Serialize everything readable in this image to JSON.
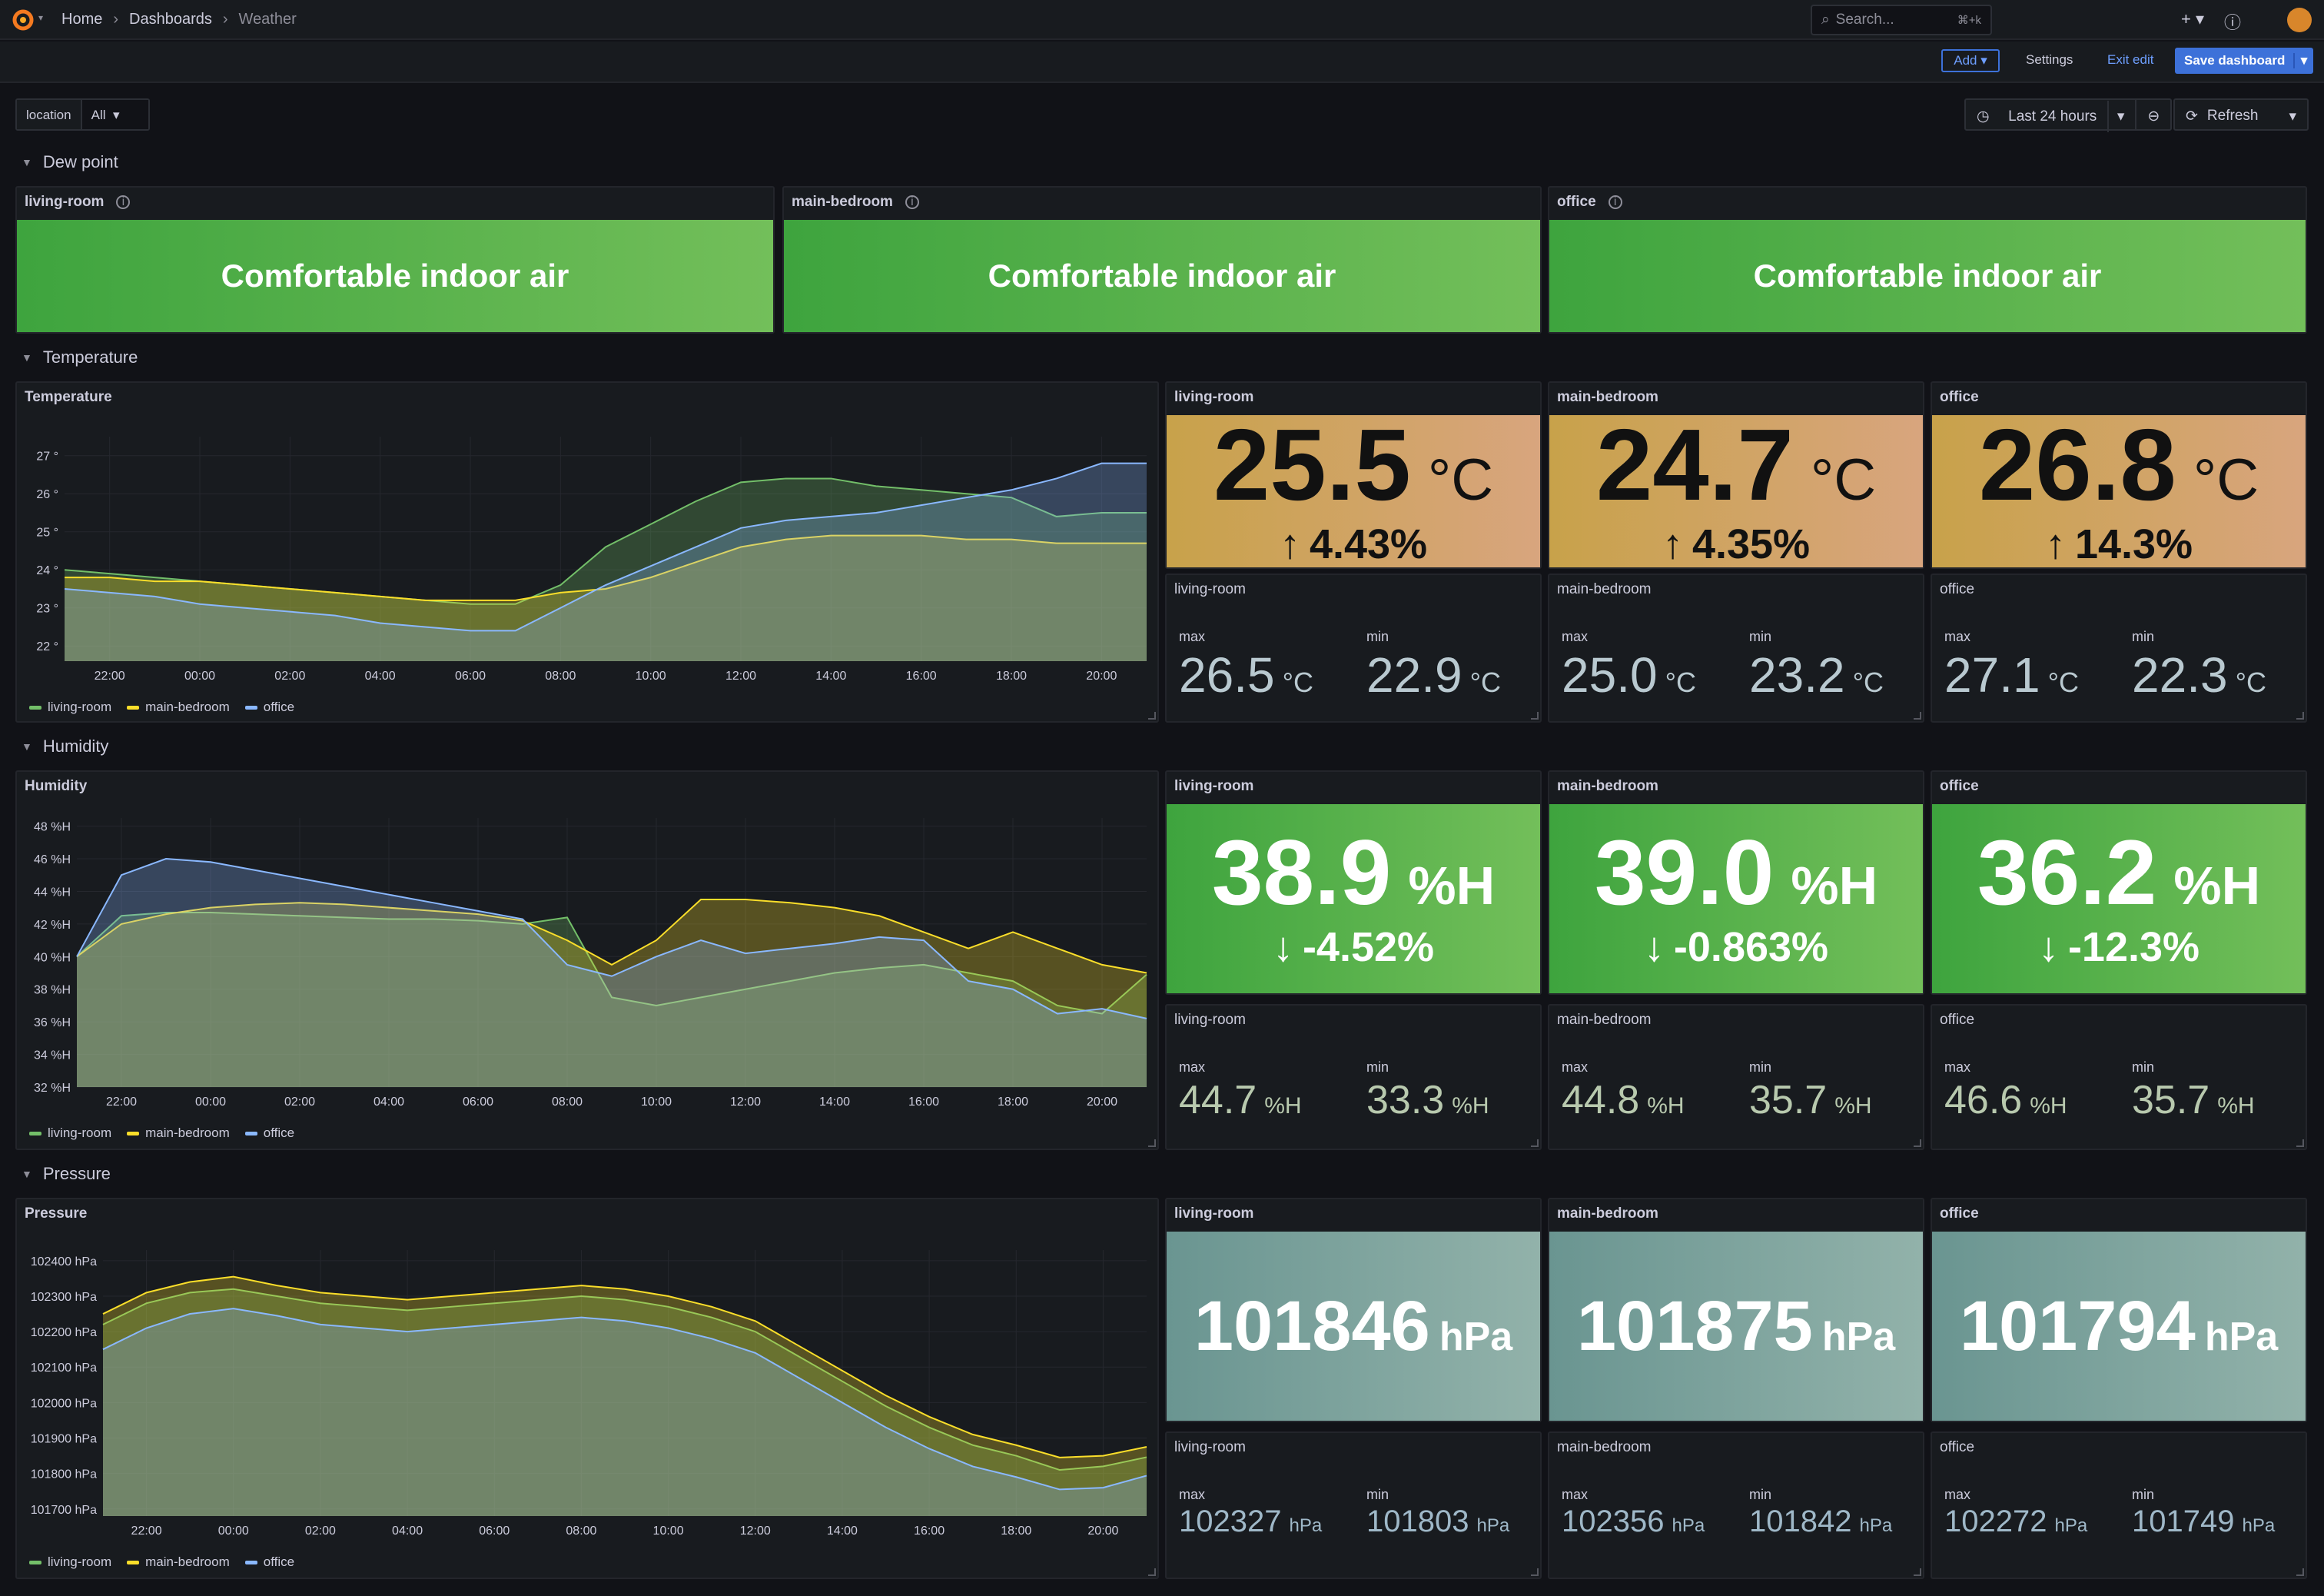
{
  "breadcrumb": {
    "home": "Home",
    "dashboards": "Dashboards",
    "current": "Weather"
  },
  "search": {
    "placeholder": "Search...",
    "shortcut": "⌘+k"
  },
  "toolbar": {
    "add": "Add",
    "settings": "Settings",
    "exit_edit": "Exit edit",
    "save": "Save dashboard"
  },
  "variable": {
    "label": "location",
    "value": "All"
  },
  "time": {
    "range": "Last 24 hours",
    "refresh": "Refresh"
  },
  "colors": {
    "living_room": "#73bf69",
    "main_bedroom": "#fade2a",
    "office": "#8ab8ff",
    "accent": "#3d71d9"
  },
  "rows": {
    "dew": "Dew point",
    "temperature": "Temperature",
    "humidity": "Humidity",
    "pressure": "Pressure"
  },
  "dew": [
    {
      "title": "living-room",
      "text": "Comfortable indoor air"
    },
    {
      "title": "main-bedroom",
      "text": "Comfortable indoor air"
    },
    {
      "title": "office",
      "text": "Comfortable indoor air"
    }
  ],
  "temperature": {
    "chart_title": "Temperature",
    "stats": [
      {
        "title": "living-room",
        "value": "25.5",
        "unit": "°C",
        "delta": "4.43%",
        "dir": "up"
      },
      {
        "title": "main-bedroom",
        "value": "24.7",
        "unit": "°C",
        "delta": "4.35%",
        "dir": "up"
      },
      {
        "title": "office",
        "value": "26.8",
        "unit": "°C",
        "delta": "14.3%",
        "dir": "up"
      }
    ],
    "minmax": [
      {
        "title": "living-room",
        "max_label": "max",
        "max": "26.5",
        "min_label": "min",
        "min": "22.9",
        "unit": "°C"
      },
      {
        "title": "main-bedroom",
        "max_label": "max",
        "max": "25.0",
        "min_label": "min",
        "min": "23.2",
        "unit": "°C"
      },
      {
        "title": "office",
        "max_label": "max",
        "max": "27.1",
        "min_label": "min",
        "min": "22.3",
        "unit": "°C"
      }
    ]
  },
  "humidity": {
    "chart_title": "Humidity",
    "stats": [
      {
        "title": "living-room",
        "value": "38.9",
        "unit": "%H",
        "delta": "-4.52%",
        "dir": "down"
      },
      {
        "title": "main-bedroom",
        "value": "39.0",
        "unit": "%H",
        "delta": "-0.863%",
        "dir": "down"
      },
      {
        "title": "office",
        "value": "36.2",
        "unit": "%H",
        "delta": "-12.3%",
        "dir": "down"
      }
    ],
    "minmax": [
      {
        "title": "living-room",
        "max_label": "max",
        "max": "44.7",
        "min_label": "min",
        "min": "33.3",
        "unit": "%H"
      },
      {
        "title": "main-bedroom",
        "max_label": "max",
        "max": "44.8",
        "min_label": "min",
        "min": "35.7",
        "unit": "%H"
      },
      {
        "title": "office",
        "max_label": "max",
        "max": "46.6",
        "min_label": "min",
        "min": "35.7",
        "unit": "%H"
      }
    ]
  },
  "pressure": {
    "chart_title": "Pressure",
    "stats": [
      {
        "title": "living-room",
        "value": "101846",
        "unit": "hPa"
      },
      {
        "title": "main-bedroom",
        "value": "101875",
        "unit": "hPa"
      },
      {
        "title": "office",
        "value": "101794",
        "unit": "hPa"
      }
    ],
    "minmax": [
      {
        "title": "living-room",
        "max_label": "max",
        "max": "102327",
        "min_label": "min",
        "min": "101803",
        "unit": "hPa"
      },
      {
        "title": "main-bedroom",
        "max_label": "max",
        "max": "102356",
        "min_label": "min",
        "min": "101842",
        "unit": "hPa"
      },
      {
        "title": "office",
        "max_label": "max",
        "max": "102272",
        "min_label": "min",
        "min": "101749",
        "unit": "hPa"
      }
    ]
  },
  "chart_data": [
    {
      "type": "area",
      "title": "Temperature",
      "x": [
        "21:00",
        "22:00",
        "23:00",
        "00:00",
        "01:00",
        "02:00",
        "03:00",
        "04:00",
        "05:00",
        "06:00",
        "07:00",
        "08:00",
        "09:00",
        "10:00",
        "11:00",
        "12:00",
        "13:00",
        "14:00",
        "15:00",
        "16:00",
        "17:00",
        "18:00",
        "19:00",
        "20:00",
        "21:00"
      ],
      "x_ticks": [
        "22:00",
        "00:00",
        "02:00",
        "04:00",
        "06:00",
        "08:00",
        "10:00",
        "12:00",
        "14:00",
        "16:00",
        "18:00",
        "20:00"
      ],
      "y_ticks": [
        "22 °",
        "23 °",
        "24 °",
        "25 °",
        "26 °",
        "27 °"
      ],
      "ylim": [
        21.6,
        27.5
      ],
      "series": [
        {
          "name": "living-room",
          "color": "#73bf69",
          "values": [
            24.0,
            23.9,
            23.8,
            23.7,
            23.6,
            23.5,
            23.4,
            23.3,
            23.2,
            23.1,
            23.1,
            23.6,
            24.6,
            25.2,
            25.8,
            26.3,
            26.4,
            26.4,
            26.2,
            26.1,
            26.0,
            25.9,
            25.4,
            25.5,
            25.5
          ]
        },
        {
          "name": "main-bedroom",
          "color": "#fade2a",
          "values": [
            23.8,
            23.8,
            23.7,
            23.7,
            23.6,
            23.5,
            23.4,
            23.3,
            23.2,
            23.2,
            23.2,
            23.4,
            23.5,
            23.8,
            24.2,
            24.6,
            24.8,
            24.9,
            24.9,
            24.9,
            24.8,
            24.8,
            24.7,
            24.7,
            24.7
          ]
        },
        {
          "name": "office",
          "color": "#8ab8ff",
          "values": [
            23.5,
            23.4,
            23.3,
            23.1,
            23.0,
            22.9,
            22.8,
            22.6,
            22.5,
            22.4,
            22.4,
            23.0,
            23.6,
            24.1,
            24.6,
            25.1,
            25.3,
            25.4,
            25.5,
            25.7,
            25.9,
            26.1,
            26.4,
            26.8,
            26.8
          ]
        }
      ],
      "legend": [
        "living-room",
        "main-bedroom",
        "office"
      ]
    },
    {
      "type": "area",
      "title": "Humidity",
      "x": [
        "21:00",
        "22:00",
        "23:00",
        "00:00",
        "01:00",
        "02:00",
        "03:00",
        "04:00",
        "05:00",
        "06:00",
        "07:00",
        "08:00",
        "09:00",
        "10:00",
        "11:00",
        "12:00",
        "13:00",
        "14:00",
        "15:00",
        "16:00",
        "17:00",
        "18:00",
        "19:00",
        "20:00",
        "21:00"
      ],
      "x_ticks": [
        "22:00",
        "00:00",
        "02:00",
        "04:00",
        "06:00",
        "08:00",
        "10:00",
        "12:00",
        "14:00",
        "16:00",
        "18:00",
        "20:00"
      ],
      "y_ticks": [
        "32 %H",
        "34 %H",
        "36 %H",
        "38 %H",
        "40 %H",
        "42 %H",
        "44 %H",
        "46 %H",
        "48 %H"
      ],
      "ylim": [
        32,
        48.5
      ],
      "series": [
        {
          "name": "living-room",
          "color": "#73bf69",
          "values": [
            40.0,
            42.5,
            42.7,
            42.7,
            42.6,
            42.5,
            42.4,
            42.3,
            42.3,
            42.2,
            42.0,
            42.4,
            37.5,
            37.0,
            37.5,
            38.0,
            38.5,
            39.0,
            39.3,
            39.5,
            39.0,
            38.5,
            37.0,
            36.5,
            38.9
          ]
        },
        {
          "name": "main-bedroom",
          "color": "#fade2a",
          "values": [
            40.0,
            42.0,
            42.6,
            43.0,
            43.2,
            43.3,
            43.2,
            43.0,
            42.8,
            42.6,
            42.2,
            41.0,
            39.5,
            41.0,
            43.5,
            43.5,
            43.3,
            43.0,
            42.5,
            41.5,
            40.5,
            41.5,
            40.5,
            39.5,
            39.0
          ]
        },
        {
          "name": "office",
          "color": "#8ab8ff",
          "values": [
            40.0,
            45.0,
            46.0,
            45.8,
            45.3,
            44.8,
            44.3,
            43.8,
            43.3,
            42.8,
            42.3,
            39.5,
            38.8,
            40.0,
            41.0,
            40.2,
            40.5,
            40.8,
            41.2,
            41.0,
            38.5,
            38.0,
            36.5,
            36.8,
            36.2
          ]
        }
      ],
      "legend": [
        "living-room",
        "main-bedroom",
        "office"
      ]
    },
    {
      "type": "area",
      "title": "Pressure",
      "x": [
        "21:00",
        "22:00",
        "23:00",
        "00:00",
        "01:00",
        "02:00",
        "03:00",
        "04:00",
        "05:00",
        "06:00",
        "07:00",
        "08:00",
        "09:00",
        "10:00",
        "11:00",
        "12:00",
        "13:00",
        "14:00",
        "15:00",
        "16:00",
        "17:00",
        "18:00",
        "19:00",
        "20:00",
        "21:00"
      ],
      "x_ticks": [
        "22:00",
        "00:00",
        "02:00",
        "04:00",
        "06:00",
        "08:00",
        "10:00",
        "12:00",
        "14:00",
        "16:00",
        "18:00",
        "20:00"
      ],
      "y_ticks": [
        "101700 hPa",
        "101800 hPa",
        "101900 hPa",
        "102000 hPa",
        "102100 hPa",
        "102200 hPa",
        "102300 hPa",
        "102400 hPa"
      ],
      "ylim": [
        101680,
        102430
      ],
      "series": [
        {
          "name": "living-room",
          "color": "#73bf69",
          "values": [
            102220,
            102280,
            102310,
            102320,
            102300,
            102280,
            102270,
            102260,
            102270,
            102280,
            102290,
            102300,
            102290,
            102270,
            102240,
            102200,
            102130,
            102060,
            101990,
            101930,
            101880,
            101850,
            101810,
            101820,
            101846
          ]
        },
        {
          "name": "main-bedroom",
          "color": "#fade2a",
          "values": [
            102250,
            102310,
            102340,
            102355,
            102330,
            102310,
            102300,
            102290,
            102300,
            102310,
            102320,
            102330,
            102320,
            102300,
            102270,
            102230,
            102160,
            102090,
            102020,
            101960,
            101910,
            101880,
            101845,
            101850,
            101875
          ]
        },
        {
          "name": "office",
          "color": "#8ab8ff",
          "values": [
            102150,
            102210,
            102250,
            102265,
            102245,
            102220,
            102210,
            102200,
            102210,
            102220,
            102230,
            102240,
            102230,
            102210,
            102180,
            102140,
            102070,
            102000,
            101930,
            101870,
            101820,
            101790,
            101755,
            101760,
            101794
          ]
        }
      ],
      "legend": [
        "living-room",
        "main-bedroom",
        "office"
      ]
    }
  ]
}
